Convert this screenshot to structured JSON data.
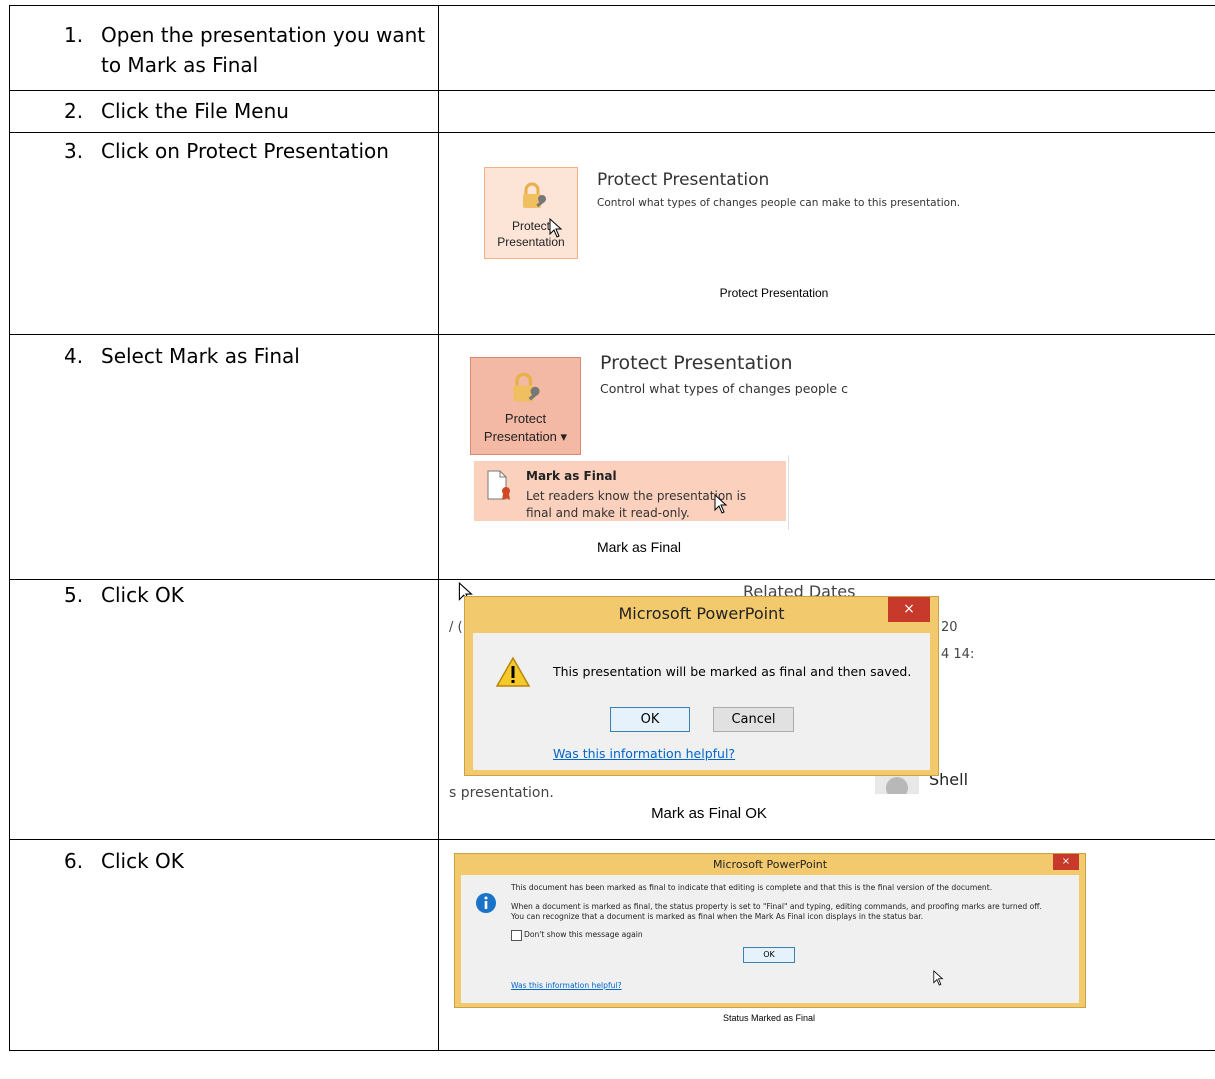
{
  "steps": [
    {
      "num": "1.",
      "text": "Open the presentation you want to Mark as Final"
    },
    {
      "num": "2.",
      "text": "Click the File Menu"
    },
    {
      "num": "3.",
      "text": "Click on Protect Presentation"
    },
    {
      "num": "4.",
      "text": "Select Mark as Final"
    },
    {
      "num": "5.",
      "text": "Click OK"
    },
    {
      "num": "6.",
      "text": "Click OK"
    }
  ],
  "shot3": {
    "button_line1": "Protect",
    "button_line2": "Presentation",
    "title": "Protect Presentation",
    "desc": "Control what types of changes people can make to this presentation.",
    "caption": "Protect Presentation"
  },
  "shot4": {
    "button_line1": "Protect",
    "button_line2": "Presentation",
    "title": "Protect Presentation",
    "desc": "Control what types of changes people c",
    "menu_title": "Mark as Final",
    "menu_desc": "Let readers know the presentation is final and make it read-only.",
    "caption": "Mark as Final"
  },
  "shot5": {
    "bg_related": "Related Dates",
    "bg_v1": "20",
    "bg_v2": "4 14:",
    "bg_left": "/ (",
    "bg_bottom": "s presentation.",
    "bg_name": "Shell",
    "dialog_title": "Microsoft PowerPoint",
    "close": "×",
    "message": "This presentation will be marked as final and then saved.",
    "ok": "OK",
    "cancel": "Cancel",
    "help_link": "Was this information helpful?",
    "caption": "Mark as Final OK"
  },
  "shot6": {
    "dialog_title": "Microsoft PowerPoint",
    "close": "×",
    "line1": "This document has been marked as final to indicate that editing is complete and that this is the final version of the document.",
    "line2": "When a document is marked as final, the status property is set to \"Final\" and typing, editing commands, and proofing marks are turned off.",
    "line3": "You can recognize that a document is marked as final when the Mark As Final icon displays in the status bar.",
    "checkbox_label": "Don't show this message again",
    "ok": "OK",
    "help_link": "Was this information helpful?",
    "caption": "Status Marked as Final"
  },
  "colors": {
    "accent": "#f4b9a5",
    "dialog_frame": "#f2ca6d",
    "close_red": "#c7392b",
    "link": "#0066cc"
  }
}
